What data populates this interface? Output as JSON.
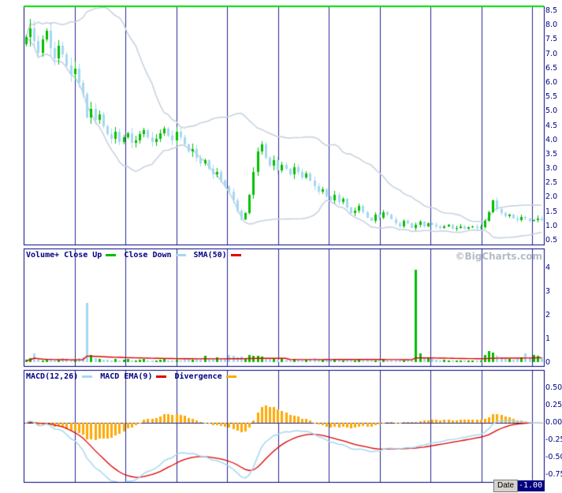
{
  "watermark": "©BigCharts.com",
  "tooltip": {
    "label": "Date",
    "value": "-1.00"
  },
  "colors": {
    "background": "#ffffff",
    "border": "#000080",
    "grid": "#24249b",
    "axis_text": "#000080",
    "top_line": "#00dd00",
    "up": "#00bf00",
    "down": "#a6d8f0",
    "band": "#c9d3df",
    "volume_sma": "#e60000",
    "macd_line": "#a6d8f0",
    "macd_signal": "#dd0000",
    "divergence": "#ffaa00",
    "watermark": "#b4bcc6",
    "tooltip_bg": "#d6d3ce",
    "tooltip_text": "#000000",
    "tooltip_value_bg": "#000080",
    "tooltip_value_text": "#ffffff"
  },
  "price_panel": {
    "ticks": [
      "8.5",
      "8.0",
      "7.5",
      "7.0",
      "6.5",
      "6.0",
      "5.5",
      "5.0",
      "4.5",
      "4.0",
      "3.5",
      "3.0",
      "2.5",
      "2.0",
      "1.5",
      "1.0",
      "0.5"
    ]
  },
  "volume_panel": {
    "legend": [
      {
        "label": "Volume+ Close Up",
        "color_key": "up"
      },
      {
        "label": "Close Down",
        "color_key": "down"
      },
      {
        "label": "SMA(50)",
        "color_key": "volume_sma"
      }
    ],
    "ticks": [
      "4",
      "3",
      "2",
      "1",
      "0"
    ]
  },
  "macd_panel": {
    "legend": [
      {
        "label": "MACD(12,26)",
        "color_key": "macd_line"
      },
      {
        "label": "MACD EMA(9)",
        "color_key": "macd_signal"
      },
      {
        "label": "Divergence",
        "color_key": "divergence"
      }
    ],
    "ticks": [
      "0.50",
      "0.25",
      "0.00",
      "-0.25",
      "-0.50",
      "-0.75"
    ]
  },
  "chart_data": [
    {
      "type": "candlestick",
      "name": "Daily price with Bollinger Bands",
      "ylim": [
        0.5,
        8.5
      ],
      "bars": 128,
      "overlays": [
        "Bollinger upper band",
        "Bollinger lower band"
      ],
      "close": [
        7.6,
        7.9,
        7.45,
        7.05,
        7.5,
        7.8,
        7.2,
        6.85,
        7.3,
        7.0,
        6.6,
        6.3,
        6.5,
        6.0,
        5.6,
        4.8,
        5.1,
        4.7,
        4.9,
        4.5,
        4.2,
        4.05,
        4.3,
        3.95,
        4.1,
        4.25,
        3.9,
        4.0,
        4.2,
        4.35,
        4.1,
        3.95,
        4.05,
        4.25,
        4.4,
        4.15,
        4.0,
        4.3,
        4.1,
        3.85,
        3.6,
        3.7,
        3.4,
        3.2,
        3.3,
        3.0,
        2.8,
        2.9,
        2.6,
        2.4,
        2.2,
        1.9,
        1.55,
        1.25,
        1.45,
        2.1,
        2.9,
        3.6,
        3.85,
        3.4,
        3.1,
        3.3,
        2.95,
        3.15,
        3.0,
        2.8,
        3.05,
        2.9,
        2.7,
        2.85,
        2.6,
        2.4,
        2.2,
        2.3,
        2.05,
        1.9,
        2.1,
        1.85,
        1.95,
        1.65,
        1.45,
        1.55,
        1.7,
        1.5,
        1.3,
        1.2,
        1.4,
        1.3,
        1.5,
        1.4,
        1.25,
        1.1,
        1.0,
        1.2,
        1.1,
        0.95,
        1.05,
        1.15,
        1.0,
        1.1,
        1.05,
        1.0,
        0.95,
        1.0,
        1.05,
        0.9,
        0.95,
        1.0,
        0.92,
        0.96,
        1.0,
        0.94,
        0.98,
        1.2,
        1.5,
        1.9,
        1.6,
        1.45,
        1.35,
        1.4,
        1.28,
        1.22,
        1.32,
        1.26,
        1.18,
        1.22,
        1.28,
        1.22
      ]
    },
    {
      "type": "bar",
      "name": "Volume (millions)",
      "ylim": [
        0,
        4
      ],
      "legend": [
        "Volume+ Close Up",
        "Close Down",
        "SMA(50)"
      ],
      "values": [
        0.1,
        0.15,
        0.35,
        0.12,
        0.08,
        0.1,
        0.12,
        0.08,
        0.1,
        0.15,
        0.12,
        0.1,
        0.08,
        0.15,
        0.2,
        2.5,
        0.3,
        0.15,
        0.12,
        0.1,
        0.1,
        0.08,
        0.12,
        0.08,
        0.1,
        0.12,
        0.08,
        0.06,
        0.1,
        0.12,
        0.08,
        0.06,
        0.08,
        0.1,
        0.12,
        0.08,
        0.06,
        0.1,
        0.08,
        0.15,
        0.12,
        0.1,
        0.15,
        0.12,
        0.25,
        0.15,
        0.12,
        0.2,
        0.15,
        0.18,
        0.3,
        0.25,
        0.2,
        0.22,
        0.18,
        0.3,
        0.25,
        0.28,
        0.22,
        0.15,
        0.12,
        0.15,
        0.1,
        0.12,
        0.1,
        0.08,
        0.12,
        0.1,
        0.08,
        0.1,
        0.12,
        0.15,
        0.12,
        0.1,
        0.12,
        0.1,
        0.12,
        0.1,
        0.08,
        0.12,
        0.1,
        0.08,
        0.1,
        0.08,
        0.1,
        0.08,
        0.06,
        0.08,
        0.1,
        0.08,
        0.06,
        0.08,
        0.1,
        0.08,
        0.06,
        0.1,
        3.9,
        0.35,
        0.2,
        0.15,
        0.12,
        0.1,
        0.08,
        0.1,
        0.08,
        0.06,
        0.08,
        0.06,
        0.08,
        0.06,
        0.08,
        0.06,
        0.08,
        0.3,
        0.45,
        0.4,
        0.25,
        0.2,
        0.15,
        0.12,
        0.1,
        0.12,
        0.2,
        0.35,
        0.15,
        0.3,
        0.25,
        0.2
      ]
    },
    {
      "type": "line",
      "name": "MACD",
      "ylim": [
        -1.0,
        0.5
      ],
      "series": [
        "MACD(12,26)",
        "MACD EMA(9)",
        "Divergence"
      ],
      "params": {
        "fast": 12,
        "slow": 26,
        "signal": 9
      },
      "computed_from": "close"
    }
  ]
}
